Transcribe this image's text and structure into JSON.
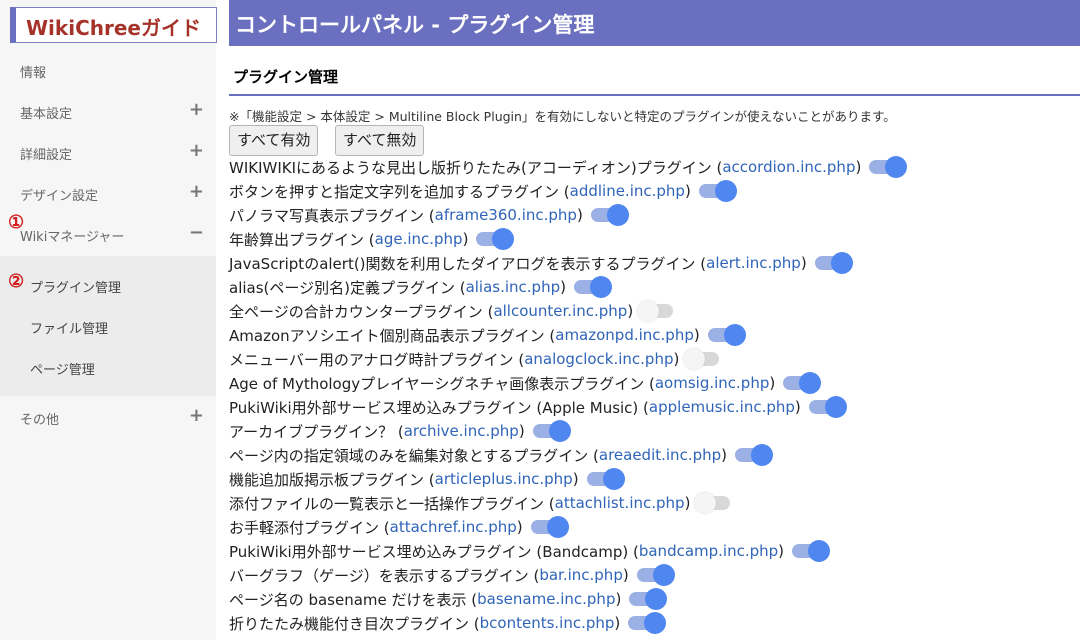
{
  "brand": "WikiChreeガイド",
  "header_title": "コントロールパネル - プラグイン管理",
  "sidebar": {
    "items": [
      {
        "label": "情報",
        "sign": ""
      },
      {
        "label": "基本設定",
        "sign": "+"
      },
      {
        "label": "詳細設定",
        "sign": "+"
      },
      {
        "label": "デザイン設定",
        "sign": "+"
      },
      {
        "label": "Wikiマネージャー",
        "sign": "−"
      },
      {
        "label": "その他",
        "sign": "+"
      }
    ],
    "subitems": [
      {
        "label": "プラグイン管理"
      },
      {
        "label": "ファイル管理"
      },
      {
        "label": "ページ管理"
      }
    ],
    "markers": [
      "①",
      "②"
    ]
  },
  "main": {
    "section_title": "プラグイン管理",
    "notice": "※「機能設定 > 本体設定 > Multiline Block Plugin」を有効にしないと特定のプラグインが使えないことがあります。",
    "enable_all": "すべて有効",
    "disable_all": "すべて無効",
    "plugins": [
      {
        "desc": "WIKIWIKIにあるような見出し版折りたたみ(アコーディオン)プラグイン",
        "file": "accordion.inc.php",
        "enabled": true
      },
      {
        "desc": "ボタンを押すと指定文字列を追加するプラグイン",
        "file": "addline.inc.php",
        "enabled": true
      },
      {
        "desc": "パノラマ写真表示プラグイン",
        "file": "aframe360.inc.php",
        "enabled": true
      },
      {
        "desc": "年齢算出プラグイン",
        "file": "age.inc.php",
        "enabled": true
      },
      {
        "desc": "JavaScriptのalert()関数を利用したダイアログを表示するプラグイン",
        "file": "alert.inc.php",
        "enabled": true
      },
      {
        "desc": "alias(ページ別名)定義プラグイン",
        "file": "alias.inc.php",
        "enabled": true
      },
      {
        "desc": "全ページの合計カウンタープラグイン",
        "file": "allcounter.inc.php",
        "enabled": false
      },
      {
        "desc": "Amazonアソシエイト個別商品表示プラグイン",
        "file": "amazonpd.inc.php",
        "enabled": true
      },
      {
        "desc": "メニューバー用のアナログ時計プラグイン",
        "file": "analogclock.inc.php",
        "enabled": false
      },
      {
        "desc": "Age of Mythologyプレイヤーシグネチャ画像表示プラグイン",
        "file": "aomsig.inc.php",
        "enabled": true
      },
      {
        "desc": "PukiWiki用外部サービス埋め込みプラグイン (Apple Music)",
        "file": "applemusic.inc.php",
        "enabled": true
      },
      {
        "desc": "アーカイブプラグイン？",
        "file": "archive.inc.php",
        "enabled": true
      },
      {
        "desc": "ページ内の指定領域のみを編集対象とするプラグイン",
        "file": "areaedit.inc.php",
        "enabled": true
      },
      {
        "desc": "機能追加版掲示板プラグイン",
        "file": "articleplus.inc.php",
        "enabled": true
      },
      {
        "desc": "添付ファイルの一覧表示と一括操作プラグイン",
        "file": "attachlist.inc.php",
        "enabled": false
      },
      {
        "desc": "お手軽添付プラグイン",
        "file": "attachref.inc.php",
        "enabled": true
      },
      {
        "desc": "PukiWiki用外部サービス埋め込みプラグイン (Bandcamp)",
        "file": "bandcamp.inc.php",
        "enabled": true
      },
      {
        "desc": "バーグラフ（ゲージ）を表示するプラグイン",
        "file": "bar.inc.php",
        "enabled": true
      },
      {
        "desc": "ページ名の basename だけを表示",
        "file": "basename.inc.php",
        "enabled": true
      },
      {
        "desc": "折りたたみ機能付き目次プラグイン",
        "file": "bcontents.inc.php",
        "enabled": true
      }
    ]
  }
}
